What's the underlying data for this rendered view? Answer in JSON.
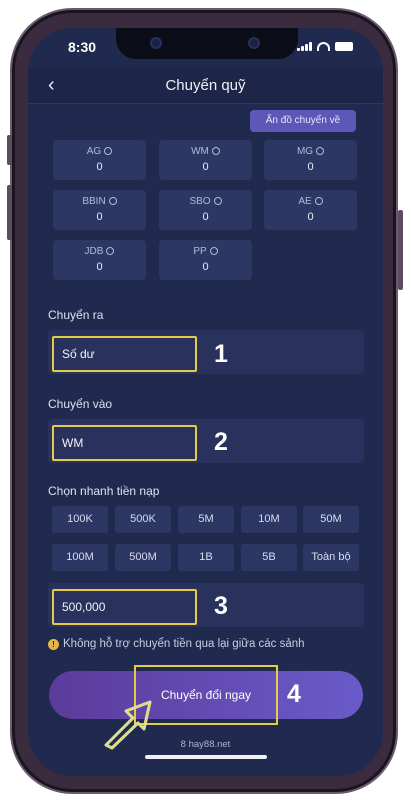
{
  "status": {
    "time": "8:30"
  },
  "nav": {
    "title": "Chuyển quỹ"
  },
  "hide_wallets_label": "Ẩn đồ chuyển về",
  "wallets": [
    {
      "name": "AG",
      "value": "0"
    },
    {
      "name": "WM",
      "value": "0"
    },
    {
      "name": "MG",
      "value": "0"
    },
    {
      "name": "BBIN",
      "value": "0"
    },
    {
      "name": "SBO",
      "value": "0"
    },
    {
      "name": "AE",
      "value": "0"
    },
    {
      "name": "JDB",
      "value": "0"
    },
    {
      "name": "PP",
      "value": "0"
    }
  ],
  "transfer_out": {
    "label": "Chuyển ra",
    "value": "Số dư",
    "step": "1"
  },
  "transfer_in": {
    "label": "Chuyển vào",
    "value": "WM",
    "step": "2"
  },
  "quick_select": {
    "label": "Chọn nhanh tiền nạp",
    "options": [
      "100K",
      "500K",
      "5M",
      "10M",
      "50M",
      "100M",
      "500M",
      "1B",
      "5B",
      "Toàn bộ"
    ]
  },
  "amount": {
    "value": "500,000",
    "step": "3"
  },
  "notice": {
    "icon": "!",
    "text": "Không hỗ trợ chuyển tiền qua lại giữa các sảnh"
  },
  "cta": {
    "label": "Chuyển đổi ngay",
    "step": "4"
  },
  "footer": {
    "site": "8 hay88.net"
  },
  "colors": {
    "background": "#1f2a4e",
    "highlight": "#e3cd45",
    "accent": "#5d57b7"
  }
}
